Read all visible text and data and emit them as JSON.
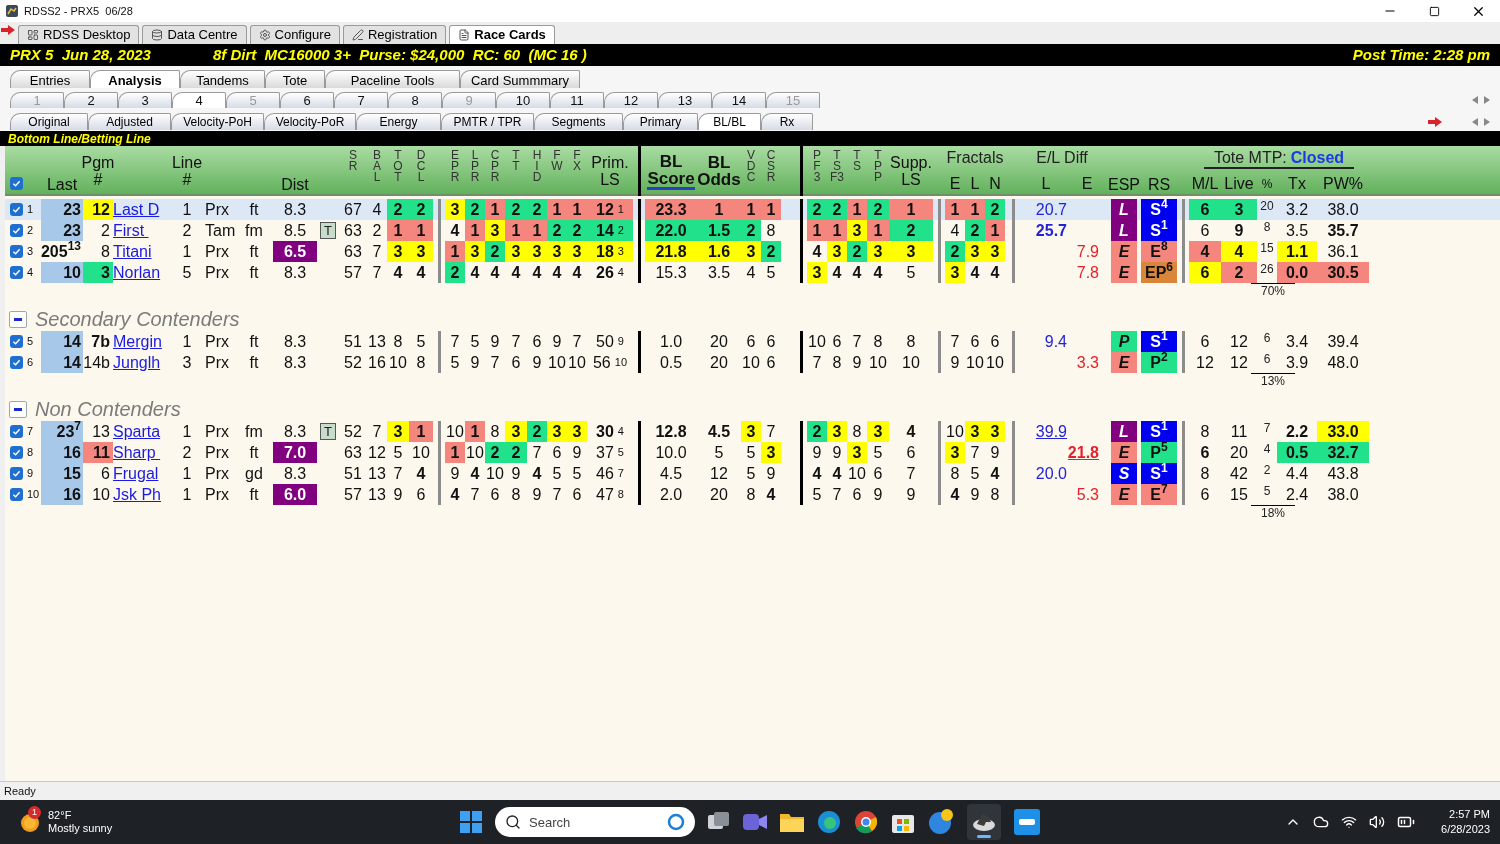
{
  "window": {
    "title": "RDSS2 - PRX5  06/28"
  },
  "app_tabs": [
    {
      "label": "RDSS Desktop",
      "selected": false
    },
    {
      "label": "Data Centre",
      "selected": false
    },
    {
      "label": "Configure",
      "selected": false
    },
    {
      "label": "Registration",
      "selected": false
    },
    {
      "label": "Race Cards",
      "selected": true
    }
  ],
  "race_bar": {
    "race": "PRX 5  Jun 28, 2023",
    "conditions": "8f Dirt  MC16000 3+  Purse: $24,000  RC: 60  (MC 16 )",
    "post_time": "Post Time: 2:28 pm"
  },
  "view_tabs": [
    {
      "label": "Entries",
      "selected": false
    },
    {
      "label": "Analysis",
      "selected": true
    },
    {
      "label": "Tandems",
      "selected": false
    },
    {
      "label": "Tote",
      "selected": false
    },
    {
      "label": "Paceline Tools",
      "selected": false
    },
    {
      "label": "Card Summmary",
      "selected": false
    }
  ],
  "race_tabs": [
    {
      "label": "1",
      "selected": false,
      "disabled": true
    },
    {
      "label": "2",
      "selected": false,
      "disabled": false
    },
    {
      "label": "3",
      "selected": false,
      "disabled": false
    },
    {
      "label": "4",
      "selected": true,
      "disabled": false
    },
    {
      "label": "5",
      "selected": false,
      "disabled": true
    },
    {
      "label": "6",
      "selected": false,
      "disabled": false
    },
    {
      "label": "7",
      "selected": false,
      "disabled": false
    },
    {
      "label": "8",
      "selected": false,
      "disabled": false
    },
    {
      "label": "9",
      "selected": false,
      "disabled": true
    },
    {
      "label": "10",
      "selected": false,
      "disabled": false
    },
    {
      "label": "11",
      "selected": false,
      "disabled": false
    },
    {
      "label": "12",
      "selected": false,
      "disabled": false
    },
    {
      "label": "13",
      "selected": false,
      "disabled": false
    },
    {
      "label": "14",
      "selected": false,
      "disabled": false
    },
    {
      "label": "15",
      "selected": false,
      "disabled": true
    }
  ],
  "method_tabs": [
    {
      "label": "Original",
      "selected": false
    },
    {
      "label": "Adjusted",
      "selected": false
    },
    {
      "label": "Velocity-PoH",
      "selected": false
    },
    {
      "label": "Velocity-PoR",
      "selected": false
    },
    {
      "label": "Energy",
      "selected": false
    },
    {
      "label": "PMTR / TPR",
      "selected": false
    },
    {
      "label": "Segments",
      "selected": false
    },
    {
      "label": "Primary",
      "selected": false
    },
    {
      "label": "BL/BL",
      "selected": true
    },
    {
      "label": "Rx",
      "selected": false
    }
  ],
  "section_label": "Bottom Line/Betting Line",
  "table": {
    "header": {
      "select_all_checked": true,
      "columns": [
        {
          "kind": "label",
          "lines": [
            "Last"
          ],
          "sorted": false
        },
        {
          "kind": "label",
          "lines": [
            "Pgm",
            "#"
          ],
          "sorted": false
        },
        {
          "kind": "label",
          "lines": [
            "Line",
            "#"
          ],
          "sorted": false
        },
        {
          "kind": "label",
          "lines": [
            "Dist"
          ],
          "sorted": false
        },
        {
          "kind": "stack",
          "lines": [
            "S",
            "R"
          ]
        },
        {
          "kind": "stack",
          "lines": [
            "B",
            "A",
            "L"
          ]
        },
        {
          "kind": "stack",
          "lines": [
            "T",
            "O",
            "T"
          ]
        },
        {
          "kind": "stack",
          "lines": [
            "D",
            "C",
            "L"
          ]
        },
        {
          "kind": "stack",
          "lines": [
            "E",
            "P",
            "R"
          ]
        },
        {
          "kind": "stack",
          "lines": [
            "L",
            "P",
            "R"
          ]
        },
        {
          "kind": "stack",
          "lines": [
            "C",
            "P",
            "R"
          ]
        },
        {
          "kind": "stack",
          "lines": [
            "T",
            "T"
          ]
        },
        {
          "kind": "stack",
          "lines": [
            "H",
            "I",
            "D"
          ]
        },
        {
          "kind": "stack",
          "lines": [
            "F",
            "W"
          ]
        },
        {
          "kind": "stack",
          "lines": [
            "F",
            "X"
          ]
        },
        {
          "kind": "label",
          "lines": [
            "Prim.",
            "LS"
          ],
          "sorted": false
        },
        {
          "kind": "strong",
          "lines": [
            "BL",
            "Score"
          ],
          "sorted": true
        },
        {
          "kind": "strong",
          "lines": [
            "BL",
            "Odds"
          ],
          "sorted": false
        },
        {
          "kind": "stack",
          "lines": [
            "V",
            "D",
            "C"
          ]
        },
        {
          "kind": "stack",
          "lines": [
            "C",
            "S",
            "R"
          ]
        },
        {
          "kind": "stack",
          "lines": [
            "P",
            "F",
            "3"
          ]
        },
        {
          "kind": "stack",
          "lines": [
            "T",
            "S",
            "F3"
          ]
        },
        {
          "kind": "stack",
          "lines": [
            "T",
            "S"
          ]
        },
        {
          "kind": "stack",
          "lines": [
            "T",
            "P",
            "P"
          ]
        },
        {
          "kind": "label",
          "lines": [
            "Supp.",
            "LS"
          ],
          "sorted": false
        },
        {
          "kind": "group",
          "title": "Fractals",
          "sub": [
            "E",
            "L",
            "N"
          ]
        },
        {
          "kind": "group",
          "title": "E/L Diff",
          "sub": [
            "L",
            "E"
          ]
        },
        {
          "kind": "label",
          "lines": [
            "ESP"
          ],
          "sorted": false
        },
        {
          "kind": "label",
          "lines": [
            "RS"
          ],
          "sorted": false
        },
        {
          "kind": "group",
          "title": "Tote MTP:",
          "status": "Closed",
          "sub": [
            "M/L",
            "Live",
            "%",
            "Tx",
            "PW%"
          ]
        }
      ]
    },
    "groups": [
      {
        "total": "70%",
        "rows": [
          {
            "number": "1",
            "checked": true,
            "selected": true,
            "cells": [
              {
                "text": "23",
                "color": "#a8c8ea"
              },
              {
                "text": "12",
                "color": "#ffff00"
              },
              "Last D",
              "1",
              "Prx",
              "ft",
              "8.3",
              null,
              "67",
              "4",
              {
                "text": "2",
                "color": "#21e28a"
              },
              {
                "text": "2",
                "color": "#21e28a"
              },
              {
                "text": "3",
                "color": "#ffff00"
              },
              {
                "text": "2",
                "color": "#21e28a"
              },
              {
                "text": "1",
                "color": "#f4867e"
              },
              {
                "text": "2",
                "color": "#21e28a"
              },
              {
                "text": "2",
                "color": "#21e28a"
              },
              {
                "text": "1",
                "color": "#f4867e"
              },
              {
                "text": "1",
                "color": "#f4867e"
              },
              {
                "text": "12",
                "rank": "1",
                "color": "#f4867e"
              },
              {
                "text": "23.3",
                "color": "#f4867e"
              },
              {
                "text": "1",
                "color": "#f4867e"
              },
              {
                "text": "1",
                "color": "#f4867e"
              },
              {
                "text": "1",
                "color": "#f4867e"
              },
              {
                "text": "2",
                "color": "#21e28a"
              },
              {
                "text": "2",
                "color": "#21e28a"
              },
              {
                "text": "1",
                "color": "#f4867e"
              },
              {
                "text": "2",
                "color": "#21e28a"
              },
              {
                "text": "1",
                "color": "#f4867e"
              },
              {
                "text": "1",
                "color": "#f4867e"
              },
              {
                "text": "1",
                "color": "#f4867e"
              },
              {
                "text": "2",
                "color": "#21e28a"
              },
              "20.7",
              null,
              {
                "text": "L",
                "color": "#800080"
              },
              {
                "text": "S$^{4}$",
                "color": "#0000f0"
              },
              {
                "text": "6",
                "color": "#21e28a"
              },
              {
                "text": "3",
                "color": "#21e28a"
              },
              "20",
              "3.2",
              "38.0"
            ]
          },
          {
            "number": "2",
            "checked": true,
            "selected": false,
            "cells": [
              {
                "text": "23",
                "color": "#a8c8ea"
              },
              "2",
              "First ",
              "2",
              "Tam",
              "fm",
              "8.5",
              "T",
              "63",
              "2",
              {
                "text": "1",
                "color": "#f4867e"
              },
              {
                "text": "1",
                "color": "#f4867e"
              },
              {
                "text": "4",
                "bold": true
              },
              {
                "text": "1",
                "color": "#f4867e"
              },
              {
                "text": "3",
                "color": "#ffff00"
              },
              {
                "text": "1",
                "color": "#f4867e"
              },
              {
                "text": "1",
                "color": "#f4867e"
              },
              {
                "text": "2",
                "color": "#21e28a"
              },
              {
                "text": "2",
                "color": "#21e28a"
              },
              {
                "text": "14",
                "rank": "2",
                "color": "#21e28a"
              },
              {
                "text": "22.0",
                "color": "#21e28a"
              },
              {
                "text": "1.5",
                "color": "#21e28a"
              },
              {
                "text": "2",
                "color": "#21e28a"
              },
              "8",
              {
                "text": "1",
                "color": "#f4867e"
              },
              {
                "text": "1",
                "color": "#f4867e"
              },
              {
                "text": "3",
                "color": "#ffff00"
              },
              {
                "text": "1",
                "color": "#f4867e"
              },
              {
                "text": "2",
                "color": "#21e28a"
              },
              "4",
              {
                "text": "2",
                "color": "#21e28a"
              },
              {
                "text": "1",
                "color": "#f4867e"
              },
              {
                "text": "25.7",
                "bold": true
              },
              null,
              {
                "text": "L",
                "color": "#800080"
              },
              {
                "text": "S$^{1}$",
                "color": "#0000f0"
              },
              "6",
              {
                "text": "9",
                "bold": true
              },
              "8",
              "3.5",
              {
                "text": "35.7",
                "bold": true
              }
            ]
          },
          {
            "number": "3",
            "checked": true,
            "selected": false,
            "cells": [
              "205$^{13}$",
              "8",
              "Titani",
              "1",
              "Prx",
              "ft",
              {
                "text": "6.5",
                "color": "#800080"
              },
              null,
              "63",
              "7",
              {
                "text": "3",
                "color": "#ffff00"
              },
              {
                "text": "3",
                "color": "#ffff00"
              },
              {
                "text": "1",
                "color": "#f4867e"
              },
              {
                "text": "3",
                "color": "#ffff00"
              },
              {
                "text": "2",
                "color": "#21e28a"
              },
              {
                "text": "3",
                "color": "#ffff00"
              },
              {
                "text": "3",
                "color": "#ffff00"
              },
              {
                "text": "3",
                "color": "#ffff00"
              },
              {
                "text": "3",
                "color": "#ffff00"
              },
              {
                "text": "18",
                "rank": "3",
                "color": "#ffff00"
              },
              {
                "text": "21.8",
                "color": "#ffff00"
              },
              {
                "text": "1.6",
                "color": "#ffff00"
              },
              {
                "text": "3",
                "color": "#ffff00"
              },
              {
                "text": "2",
                "color": "#21e28a"
              },
              {
                "text": "4",
                "bold": true
              },
              {
                "text": "3",
                "color": "#ffff00"
              },
              {
                "text": "2",
                "color": "#21e28a"
              },
              {
                "text": "3",
                "color": "#ffff00"
              },
              {
                "text": "3",
                "color": "#ffff00"
              },
              {
                "text": "2",
                "color": "#21e28a"
              },
              {
                "text": "3",
                "color": "#ffff00"
              },
              {
                "text": "3",
                "color": "#ffff00"
              },
              null,
              "7.9",
              {
                "text": "E",
                "color": "#f4867e"
              },
              {
                "text": "E$^{8}$",
                "color": "#f4867e"
              },
              {
                "text": "4",
                "color": "#f4867e"
              },
              {
                "text": "4",
                "color": "#ffff00"
              },
              "15",
              {
                "text": "1.1",
                "color": "#ffff00"
              },
              "36.1"
            ]
          },
          {
            "number": "4",
            "checked": true,
            "selected": false,
            "cells": [
              {
                "text": "10",
                "color": "#a8c8ea"
              },
              {
                "text": "3",
                "color": "#21e28a"
              },
              "Norlan",
              "5",
              "Prx",
              "ft",
              "8.3",
              null,
              "57",
              "7",
              {
                "text": "4",
                "bold": true
              },
              {
                "text": "4",
                "bold": true
              },
              {
                "text": "2",
                "color": "#21e28a"
              },
              {
                "text": "4",
                "bold": true
              },
              {
                "text": "4",
                "bold": true
              },
              {
                "text": "4",
                "bold": true
              },
              {
                "text": "4",
                "bold": true
              },
              {
                "text": "4",
                "bold": true
              },
              {
                "text": "4",
                "bold": true
              },
              {
                "text": "26",
                "rank": "4",
                "bold": true
              },
              "15.3",
              "3.5",
              "4",
              "5",
              {
                "text": "3",
                "color": "#ffff00"
              },
              {
                "text": "4",
                "bold": true
              },
              {
                "text": "4",
                "bold": true
              },
              {
                "text": "4",
                "bold": true
              },
              "5",
              {
                "text": "3",
                "color": "#ffff00"
              },
              {
                "text": "4",
                "bold": true
              },
              {
                "text": "4",
                "bold": true
              },
              null,
              "7.8",
              {
                "text": "E",
                "color": "#f4867e"
              },
              {
                "text": "EP$^{6}$",
                "color": "#d9863a"
              },
              {
                "text": "6",
                "color": "#ffff00"
              },
              {
                "text": "2",
                "color": "#f4867e"
              },
              "26",
              {
                "text": "0.0",
                "color": "#f4867e"
              },
              {
                "text": "30.5",
                "color": "#f4867e"
              }
            ]
          }
        ]
      },
      {
        "title": "Secondary Contenders",
        "expanded": true,
        "total": "13%",
        "rows": [
          {
            "number": "5",
            "checked": true,
            "selected": false,
            "cells": [
              {
                "text": "14",
                "color": "#a8c8ea"
              },
              {
                "text": "7b",
                "bold": true
              },
              "Mergin",
              "1",
              "Prx",
              "ft",
              "8.3",
              null,
              "51",
              "13",
              "8",
              "5",
              "7",
              "5",
              "9",
              "7",
              "6",
              "9",
              "7",
              {
                "text": "50",
                "rank": "9"
              },
              "1.0",
              "20",
              "6",
              "6",
              "10",
              "6",
              "7",
              "8",
              "8",
              "7",
              "6",
              "6",
              "9.4",
              null,
              {
                "text": "P",
                "color": "#21e28a"
              },
              {
                "text": "S$^{1}$",
                "color": "#0000f0"
              },
              "6",
              "12",
              "6",
              "3.4",
              "39.4"
            ]
          },
          {
            "number": "6",
            "checked": true,
            "selected": false,
            "cells": [
              {
                "text": "14",
                "color": "#a8c8ea"
              },
              "14b",
              "Junglh",
              "3",
              "Prx",
              "ft",
              "8.3",
              null,
              "52",
              "16",
              "10",
              "8",
              "5",
              "9",
              "7",
              "6",
              "9",
              "10",
              "10",
              {
                "text": "56",
                "rank": "10"
              },
              "0.5",
              "20",
              "10",
              "6",
              "7",
              "8",
              "9",
              "10",
              "10",
              "9",
              "10",
              "10",
              null,
              "3.3",
              {
                "text": "E",
                "color": "#f4867e"
              },
              {
                "text": "P$^{2}$",
                "color": "#21e28a"
              },
              "12",
              "12",
              "6",
              "3.9",
              "48.0"
            ]
          }
        ]
      },
      {
        "title": "Non Contenders",
        "expanded": true,
        "total": "18%",
        "rows": [
          {
            "number": "7",
            "checked": true,
            "selected": false,
            "cells": [
              {
                "text": "23$^{7}$",
                "color": "#a8c8ea"
              },
              "13",
              "Sparta",
              "1",
              "Prx",
              "fm",
              "8.3",
              "T",
              "52",
              "7",
              {
                "text": "3",
                "color": "#ffff00"
              },
              {
                "text": "1",
                "color": "#f4867e"
              },
              "10",
              {
                "text": "1",
                "color": "#f4867e"
              },
              "8",
              {
                "text": "3",
                "color": "#ffff00"
              },
              {
                "text": "2",
                "color": "#21e28a"
              },
              {
                "text": "3",
                "color": "#ffff00"
              },
              {
                "text": "3",
                "color": "#ffff00"
              },
              {
                "text": "30",
                "rank": "4",
                "bold": true
              },
              {
                "text": "12.8",
                "bold": true
              },
              {
                "text": "4.5",
                "bold": true
              },
              {
                "text": "3",
                "color": "#ffff00"
              },
              "7",
              {
                "text": "2",
                "color": "#21e28a"
              },
              {
                "text": "3",
                "color": "#ffff00"
              },
              "8",
              {
                "text": "3",
                "color": "#ffff00"
              },
              {
                "text": "4",
                "bold": true
              },
              "10",
              {
                "text": "3",
                "color": "#ffff00"
              },
              {
                "text": "3",
                "color": "#ffff00"
              },
              {
                "text": "39.9",
                "underline": true
              },
              null,
              {
                "text": "L",
                "color": "#800080"
              },
              {
                "text": "S$^{1}$",
                "color": "#0000f0"
              },
              "8",
              "11",
              "7",
              {
                "text": "2.2",
                "bold": true
              },
              {
                "text": "33.0",
                "color": "#ffff00"
              }
            ]
          },
          {
            "number": "8",
            "checked": true,
            "selected": false,
            "cells": [
              {
                "text": "16",
                "color": "#a8c8ea"
              },
              {
                "text": "11",
                "color": "#f4867e"
              },
              "Sharp ",
              "2",
              "Prx",
              "ft",
              {
                "text": "7.0",
                "color": "#800080"
              },
              null,
              "63",
              "12",
              "5",
              "10",
              {
                "text": "1",
                "color": "#f4867e"
              },
              "10",
              {
                "text": "2",
                "color": "#21e28a"
              },
              {
                "text": "2",
                "color": "#21e28a"
              },
              "7",
              "6",
              "9",
              {
                "text": "37",
                "rank": "5"
              },
              "10.0",
              "5",
              "5",
              {
                "text": "3",
                "color": "#ffff00"
              },
              "9",
              "9",
              {
                "text": "3",
                "color": "#ffff00"
              },
              "5",
              "6",
              {
                "text": "3",
                "color": "#ffff00"
              },
              "7",
              "9",
              null,
              {
                "text": "21.8",
                "underline": true,
                "bold": true
              },
              {
                "text": "E",
                "color": "#f4867e"
              },
              {
                "text": "P$^{5}$",
                "color": "#21e28a"
              },
              {
                "text": "6",
                "bold": true
              },
              "20",
              "4",
              {
                "text": "0.5",
                "color": "#21e28a"
              },
              {
                "text": "32.7",
                "color": "#21e28a"
              }
            ]
          },
          {
            "number": "9",
            "checked": true,
            "selected": false,
            "cells": [
              {
                "text": "15",
                "color": "#a8c8ea"
              },
              "6",
              "Frugal",
              "1",
              "Prx",
              "gd",
              "8.3",
              null,
              "51",
              "13",
              "7",
              {
                "text": "4",
                "bold": true
              },
              "9",
              {
                "text": "4",
                "bold": true
              },
              "10",
              "9",
              {
                "text": "4",
                "bold": true
              },
              "5",
              "5",
              {
                "text": "46",
                "rank": "7"
              },
              "4.5",
              "12",
              "5",
              "9",
              {
                "text": "4",
                "bold": true
              },
              {
                "text": "4",
                "bold": true
              },
              "10",
              "6",
              "7",
              "8",
              "5",
              {
                "text": "4",
                "bold": true
              },
              "20.0",
              null,
              {
                "text": "S",
                "color": "#0000f0"
              },
              {
                "text": "S$^{1}$",
                "color": "#0000f0"
              },
              "8",
              "42",
              "2",
              "4.4",
              "43.8"
            ]
          },
          {
            "number": "10",
            "checked": true,
            "selected": false,
            "cells": [
              {
                "text": "16",
                "color": "#a8c8ea"
              },
              "10",
              "Jsk Ph",
              "1",
              "Prx",
              "ft",
              {
                "text": "6.0",
                "color": "#800080"
              },
              null,
              "57",
              "13",
              "9",
              "6",
              {
                "text": "4",
                "bold": true
              },
              "7",
              "6",
              "8",
              "9",
              "7",
              "6",
              {
                "text": "47",
                "rank": "8"
              },
              "2.0",
              "20",
              "8",
              {
                "text": "4",
                "bold": true
              },
              "5",
              "7",
              "6",
              "9",
              "9",
              {
                "text": "4",
                "bold": true
              },
              "9",
              "8",
              null,
              "5.3",
              {
                "text": "E",
                "color": "#f4867e"
              },
              {
                "text": "E$^{7}$",
                "color": "#f4867e"
              },
              "6",
              "15",
              "5",
              "2.4",
              "38.0"
            ]
          }
        ]
      }
    ]
  },
  "status_bar": "Ready",
  "taskbar": {
    "weather": {
      "temperature": "82°F",
      "condition": "Mostly sunny",
      "badge": "1"
    },
    "search": {
      "placeholder": "Search"
    },
    "clock": {
      "time": "2:57 PM",
      "date": "6/28/2023"
    }
  }
}
